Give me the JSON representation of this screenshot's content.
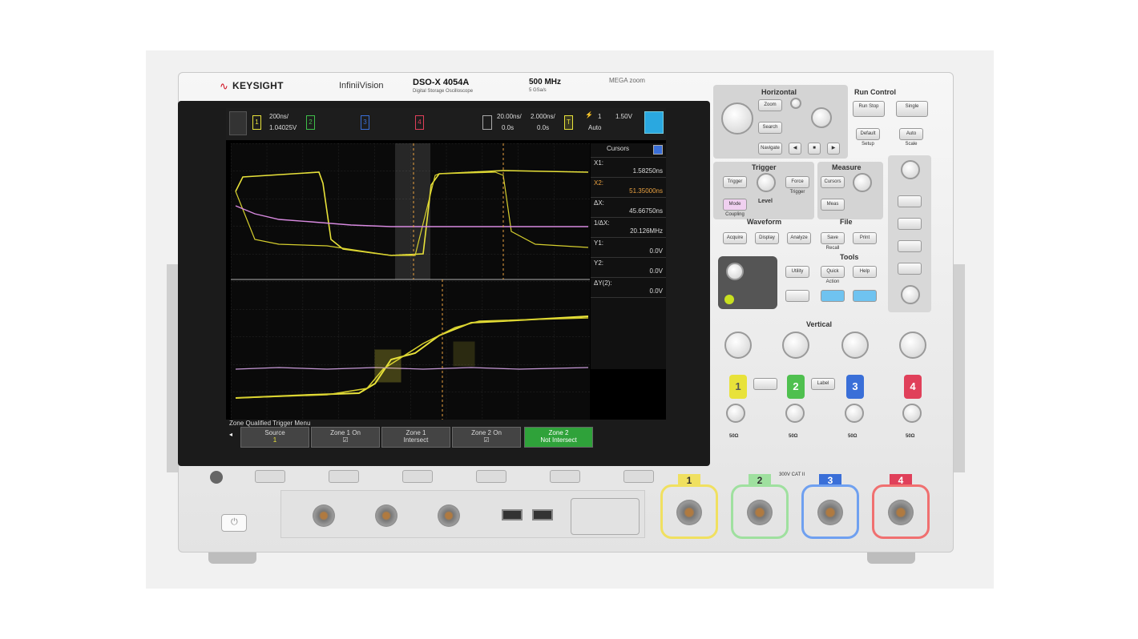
{
  "brand": {
    "logo_icon": "keysight-wave-icon",
    "name": "KEYSIGHT"
  },
  "instrument": {
    "series": "InfiniiVision",
    "model": "DSO-X 4054A",
    "model_sub": "Digital Storage Oscilloscope",
    "bandwidth": "500 MHz",
    "sample_rate": "5 GSa/s",
    "badge": "MEGA zoom"
  },
  "screen": {
    "timebase": "200ns/",
    "delay": "1.04025V",
    "channels": [
      "1",
      "2",
      "3",
      "4"
    ],
    "channel_colors": [
      "#e8e23a",
      "#3fbf4a",
      "#3a6fd8",
      "#e0405a"
    ],
    "scale1": "20.00ns/",
    "pos1": "0.0s",
    "scale2": "2.000ns/",
    "pos2": "0.0s",
    "trig_level": "1",
    "trig_label": "Auto",
    "volt": "1.50V",
    "cursors": {
      "title": "Cursors",
      "rows": [
        {
          "label": "X1:",
          "value": "1.58250ns"
        },
        {
          "label": "X2:",
          "value": "51.35000ns"
        },
        {
          "label": "ΔX:",
          "value": "45.66750ns"
        },
        {
          "label": "1/ΔX:",
          "value": "20.126MHz"
        },
        {
          "label": "Y1:",
          "value": "0.0V"
        },
        {
          "label": "Y2:",
          "value": "0.0V"
        },
        {
          "label": "ΔY(2):",
          "value": "0.0V"
        }
      ]
    },
    "menu_title": "Zone Qualified Trigger Menu",
    "softkeys": [
      {
        "top": "Source",
        "bottom": "1"
      },
      {
        "top": "Zone 1 On",
        "bottom": "☑"
      },
      {
        "top": "Zone 1",
        "bottom": "Intersect"
      },
      {
        "top": "Zone 2 On",
        "bottom": "☑"
      },
      {
        "top": "Zone 2",
        "bottom": "Not Intersect"
      }
    ]
  },
  "panel": {
    "horizontal": "Horizontal",
    "run_control": "Run Control",
    "run_stop": "Run Stop",
    "single": "Single",
    "default_setup": "Default Setup",
    "auto_scale": "Auto Scale",
    "zoom": "Zoom",
    "search": "Search",
    "navigate": "Navigate",
    "trigger": "Trigger",
    "measure": "Measure",
    "waveform": "Waveform",
    "file": "File",
    "tools": "Tools",
    "vertical": "Vertical",
    "trig_buttons": [
      "Trigger",
      "Force Trigger",
      "Mode Coupling"
    ],
    "level": "Level",
    "meas_buttons": [
      "Cursors",
      "Meas"
    ],
    "wave_buttons": [
      "Acquire",
      "Display",
      "Analyze"
    ],
    "file_buttons": [
      "Save Recall",
      "Print"
    ],
    "tool_buttons": [
      "Utility",
      "Quick Action",
      "Help"
    ],
    "vertical_label": "Label",
    "channel_numbers": [
      "1",
      "2",
      "3",
      "4"
    ],
    "bottom_labels": [
      "50Ω",
      "50Ω",
      "50Ω",
      "50Ω"
    ]
  },
  "inputs": {
    "numbers": [
      "1",
      "2",
      "3",
      "4"
    ],
    "rating": "300V CAT II",
    "colors": [
      "#f0e060",
      "#9fe09f",
      "#6fa0f0",
      "#f07070"
    ]
  },
  "icons": {
    "power": "power-icon",
    "usb": "usb-icon",
    "bnc": "bnc-connector-icon"
  }
}
